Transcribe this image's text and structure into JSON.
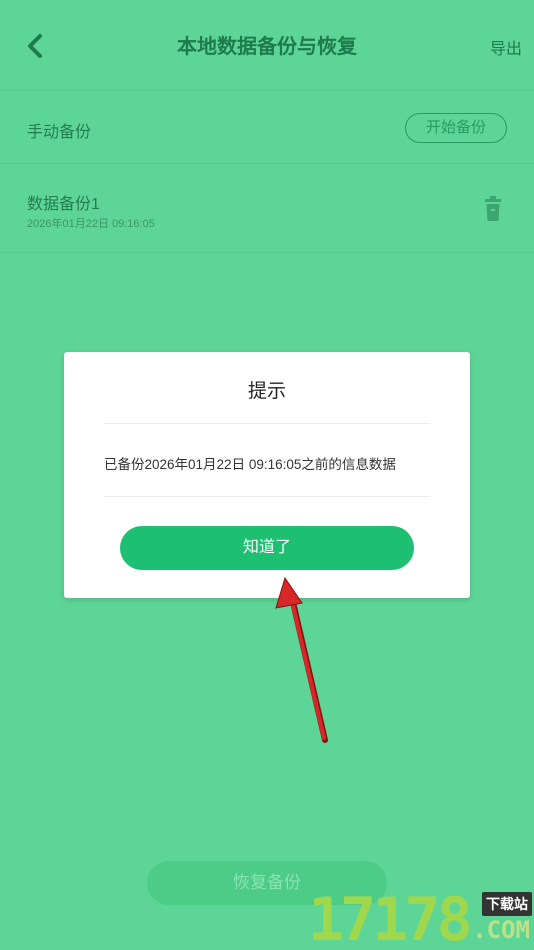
{
  "header": {
    "title": "本地数据备份与恢复",
    "export_label": "导出"
  },
  "manual": {
    "label": "手动备份",
    "start_label": "开始备份"
  },
  "backups": [
    {
      "name": "数据备份1",
      "time": "2026年01月22日 09:16:05"
    }
  ],
  "footer": {
    "restore_label": "恢复备份"
  },
  "dialog": {
    "title": "提示",
    "message": "已备份2026年01月22日 09:16:05之前的信息数据",
    "confirm_label": "知道了"
  },
  "watermark": {
    "digits": "17178",
    "tag": "下载站",
    "suffix": ".COM"
  },
  "colors": {
    "overlay_green": "#5dd596",
    "accent_green": "#1dc070",
    "arrow_red": "#d62828"
  }
}
